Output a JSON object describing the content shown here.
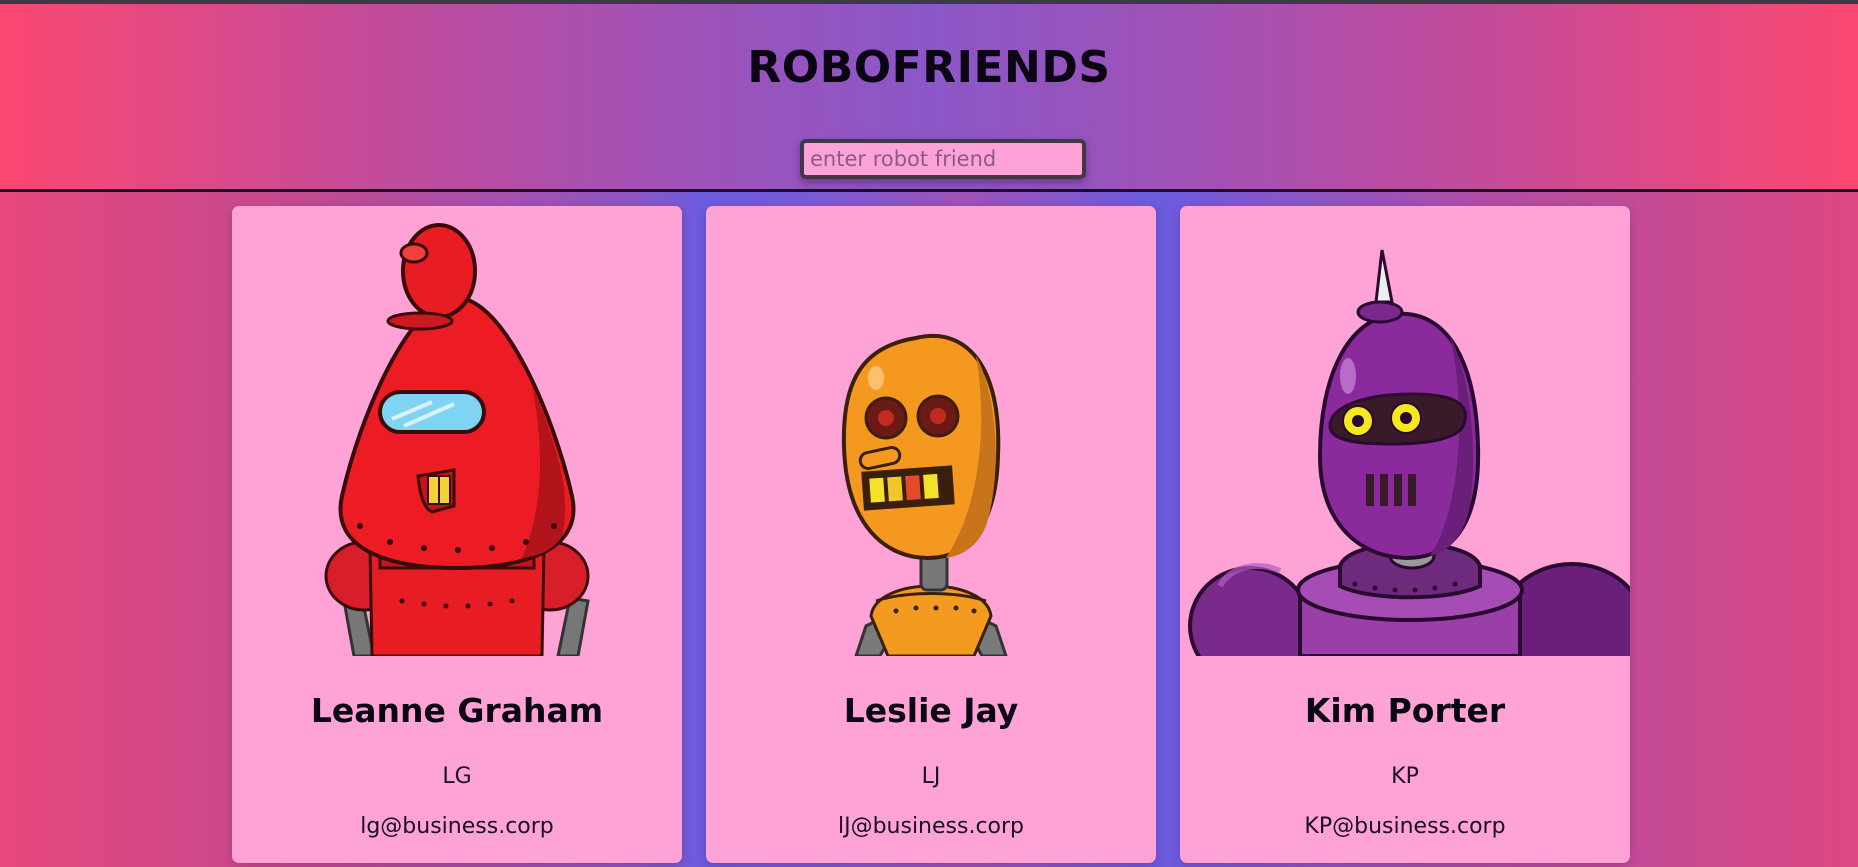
{
  "app": {
    "title": "ROBOFRIENDS"
  },
  "search": {
    "placeholder": "enter robot friend",
    "value": ""
  },
  "colors": {
    "card_background": "#ffa3d7",
    "search_background": "#ffa2d8",
    "header_accent": "#fb4871",
    "header_center": "#8b57c7"
  },
  "robots": [
    {
      "name": "Leanne Graham",
      "username": "LG",
      "email": "lg@business.corp",
      "image": "red-robot-icon"
    },
    {
      "name": "Leslie Jay",
      "username": "LJ",
      "email": "lJ@business.corp",
      "image": "orange-robot-icon"
    },
    {
      "name": "Kim Porter",
      "username": "KP",
      "email": "KP@business.corp",
      "image": "purple-robot-icon"
    }
  ]
}
